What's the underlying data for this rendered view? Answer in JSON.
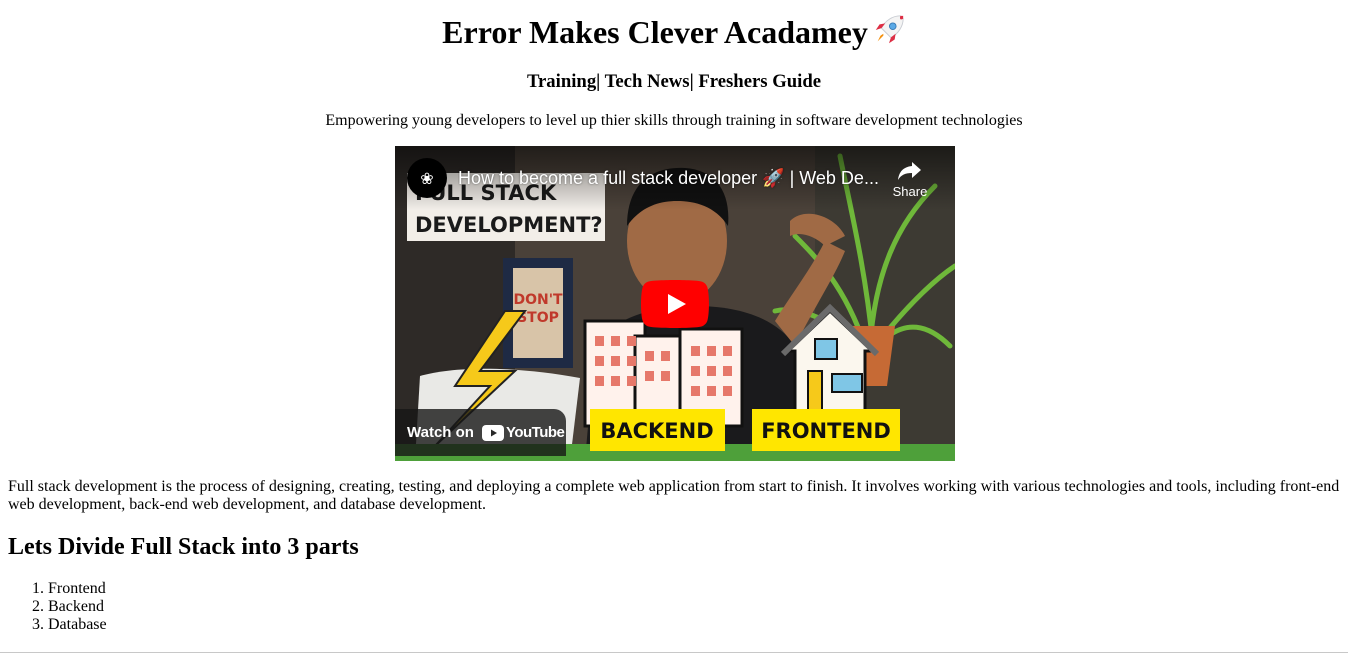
{
  "header": {
    "title": "Error Makes Clever Acadamey",
    "title_emoji": "rocket-emoji",
    "nav": "Training| Tech News| Freshers Guide",
    "tagline": "Empowering young developers to level up thier skills through training in software development technologies"
  },
  "video": {
    "title": "How to become a full stack developer 🚀 | Web De...",
    "share_label": "Share",
    "watch_on_label": "Watch on",
    "youtube_label": "YouTube",
    "thumbnail": {
      "headline_line1": "FULL STACK",
      "headline_line2": "DEVELOPMENT?",
      "poster_text": "DON'T STOP",
      "label_backend": "BACKEND",
      "label_frontend": "FRONTEND"
    },
    "colors": {
      "play_red": "#ff0000",
      "label_yellow": "#ffe600"
    }
  },
  "content": {
    "intro": "Full stack development is the process of designing, creating, testing, and deploying a complete web application from start to finish. It involves working with various technologies and tools, including front-end web development, back-end web development, and database development.",
    "heading": "Lets Divide Full Stack into 3 parts",
    "parts": [
      "Frontend",
      "Backend",
      "Database"
    ]
  }
}
